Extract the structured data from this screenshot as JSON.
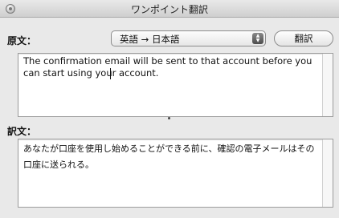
{
  "window": {
    "title": "ワンポイント翻訳"
  },
  "source": {
    "label": "原文：",
    "text": "The confirmation email will be sent to that account before you can start using your account."
  },
  "language": {
    "selected": "英語 → 日本語"
  },
  "translate_button": {
    "label": "翻訳"
  },
  "translation": {
    "label": "訳文：",
    "text": "あなたが口座を使用し始めることができる前に、確認の電子メールはその口座に送られる。"
  },
  "icons": {
    "window_control": "close-circle-icon",
    "select_arrows": "up-down-arrows-icon",
    "splitter": "resize-dot-icon"
  }
}
